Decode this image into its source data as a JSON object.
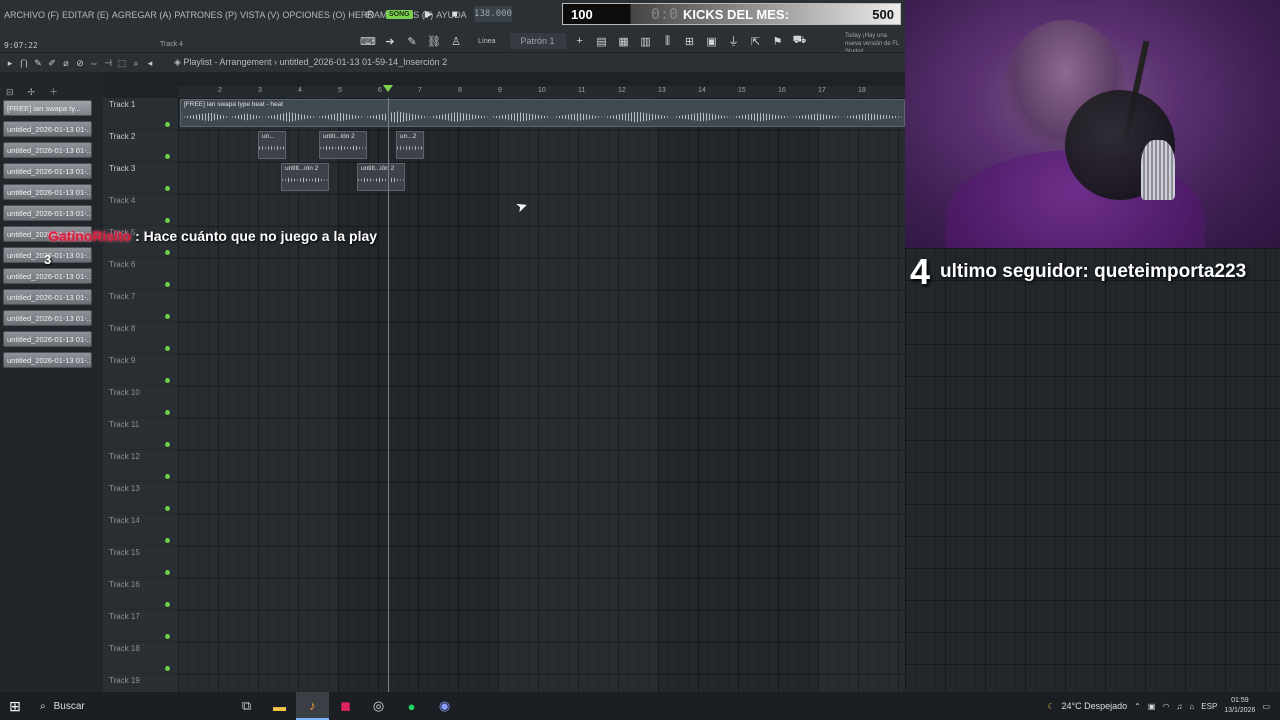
{
  "menubar": {
    "items": [
      "ARCHIVO (F)",
      "EDITAR (E)",
      "AGREGAR (A)",
      "PATRONES (P)",
      "VISTA (V)",
      "OPCIONES (O)",
      "HERRAMIENTAS (T)",
      "AYUDA"
    ],
    "song_mode_label": "SONG",
    "tempo": "138.000"
  },
  "overlay_bar": {
    "left_value": "100",
    "time": "0:0",
    "title": "KICKS DEL MES:",
    "right_value": "500"
  },
  "toolbar2": {
    "clock": "9:07:22",
    "track_label": "Track 4",
    "snap_label": "Línea",
    "pattern_label": "Patrón 1",
    "hint": "Today ¡Hay una nueva versión de FL Studio!"
  },
  "playlist": {
    "title": "Playlist - Arrangement",
    "breadcrumb_sep": "›",
    "file": "untitled_2026-01-13 01-59-14_Inserción 2"
  },
  "picker": {
    "items": [
      "[FREE] ian  swapa ty...",
      "untitled_2026-01-13 01-...",
      "untitled_2026-01-13 01-...",
      "untitled_2026-01-13 01-...",
      "untitled_2026-01-13 01-...",
      "untitled_2026-01-13 01-...",
      "untitled_2026-01-13 01-...",
      "untitled_2026-01-13 01-...",
      "untitled_2026-01-13 01-...",
      "untitled_2026-01-13 01-...",
      "untitled_2026-01-13 01-...",
      "untitled_2026-01-13 01-...",
      "untitled_2026-01-13 01-..."
    ]
  },
  "tracks": [
    "Track 1",
    "Track 2",
    "Track 3",
    "Track 4",
    "Track 5",
    "Track 6",
    "Track 7",
    "Track 8",
    "Track 9",
    "Track 10",
    "Track 11",
    "Track 12",
    "Track 13",
    "Track 14",
    "Track 15",
    "Track 16",
    "Track 17",
    "Track 18",
    "Track 19"
  ],
  "ruler": [
    "2",
    "3",
    "4",
    "5",
    "6",
    "7",
    "8",
    "9",
    "10",
    "11",
    "12",
    "13",
    "14",
    "15",
    "16",
    "17",
    "18"
  ],
  "clips": {
    "main": "[FREE] ian  swapa type beat - heat",
    "t2a": "un...",
    "t2b": "untit...ión 2",
    "t2c": "un...2",
    "t3a": "untitl...ión 2",
    "t3b": "untitl...ión 2"
  },
  "chat": {
    "user": "GatinoRisito",
    "message": " : Hace cuánto que no juego a la play",
    "count": "3"
  },
  "follower": {
    "number": "4",
    "text": "ultimo seguidor: queteimporta223"
  },
  "taskbar": {
    "search": "Buscar",
    "weather": "24°C  Despejado",
    "lang": "ESP",
    "time": "01:59",
    "date": "13/1/2026"
  }
}
